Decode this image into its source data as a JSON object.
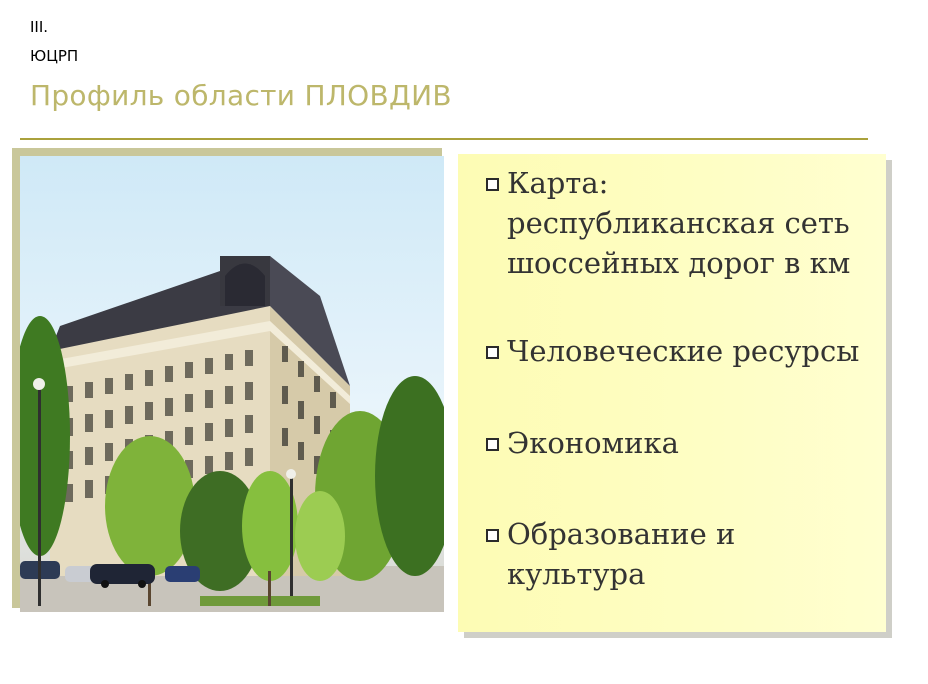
{
  "header": {
    "section_number": "III.",
    "organization": "ЮЦРП",
    "title": "Профиль области ПЛОВДИВ"
  },
  "photo": {
    "description_icon": "building-photo"
  },
  "list": {
    "items": [
      {
        "label": "Карта: республиканская сеть шоссейных дорог в км"
      },
      {
        "label": "Человеческие ресурсы"
      },
      {
        "label": "Экономика"
      },
      {
        "label": "Образование и культура"
      }
    ]
  },
  "colors": {
    "title": "#bdb76b",
    "rule": "#aaa13c",
    "list_background": "#ffffc2"
  }
}
